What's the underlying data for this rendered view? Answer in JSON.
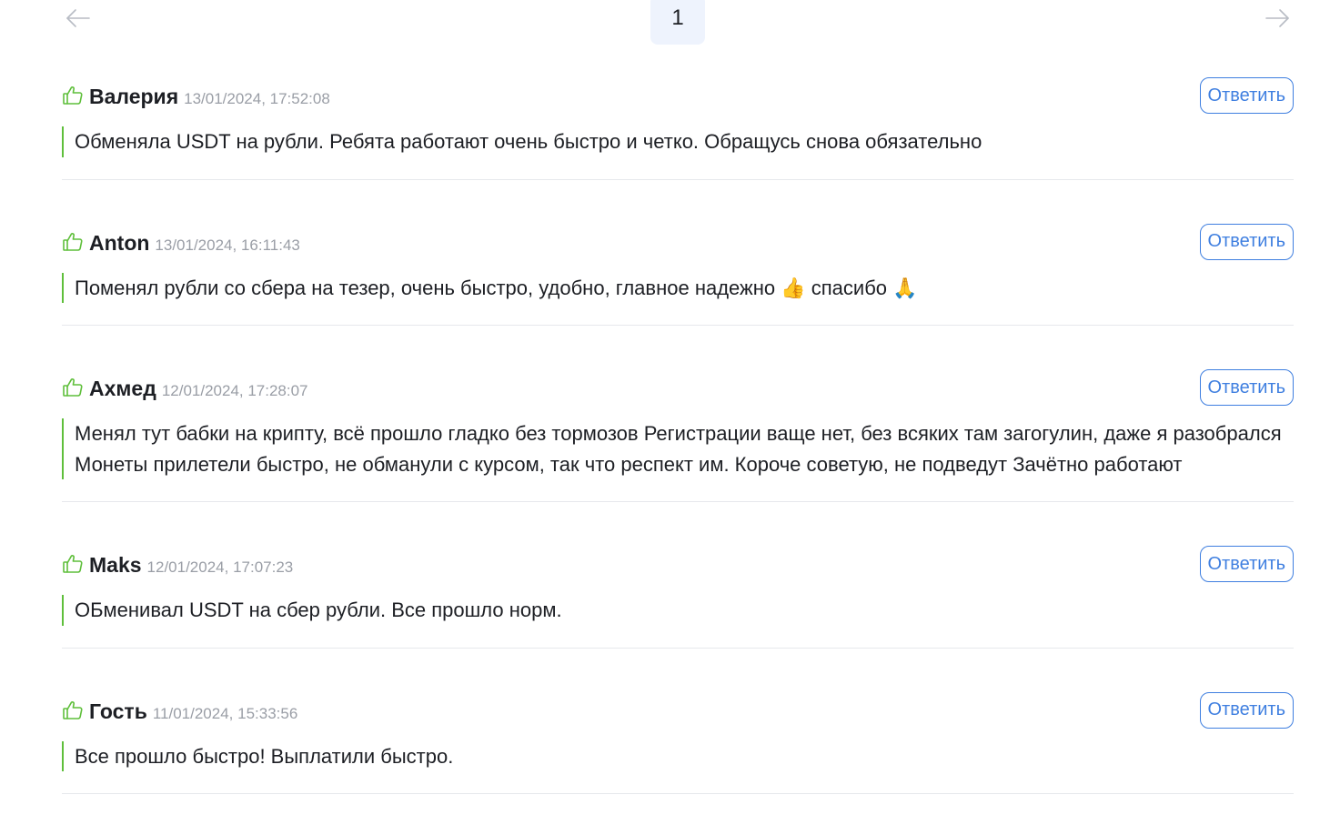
{
  "pagination": {
    "current_page": "1"
  },
  "reply_label": "Ответить",
  "reviews": [
    {
      "author": "Валерия",
      "date": "13/01/2024, 17:52:08",
      "text": "Обменяла USDT на рубли. Ребята работают очень быстро и четко. Обращусь снова обязательно"
    },
    {
      "author": "Anton",
      "date": "13/01/2024, 16:11:43",
      "text": "Поменял рубли со сбера на тезер, очень быстро, удобно, главное надежно 👍 спасибо 🙏"
    },
    {
      "author": "Ахмед",
      "date": "12/01/2024, 17:28:07",
      "text": "Менял тут бабки на крипту, всё прошло гладко без тормозов Регистрации ваще нет, без всяких там загогулин, даже я разобрался Монеты прилетели быстро, не обманули с курсом, так что респект им. Короче советую, не подведут Зачётно работают"
    },
    {
      "author": "Maks",
      "date": "12/01/2024, 17:07:23",
      "text": "ОБменивал USDT на сбер рубли. Все прошло норм."
    },
    {
      "author": "Гость",
      "date": "11/01/2024, 15:33:56",
      "text": "Все прошло быстро! Выплатили быстро."
    }
  ],
  "colors": {
    "accent": "#3f7fe0",
    "positive": "#5fbf3b",
    "muted_text": "#9a9ea6",
    "divider": "#e6e8ec",
    "page_highlight": "#eef3fd"
  },
  "icons": {
    "prev": "arrow-left-icon",
    "next": "arrow-right-icon",
    "like": "thumbs-up-icon"
  }
}
